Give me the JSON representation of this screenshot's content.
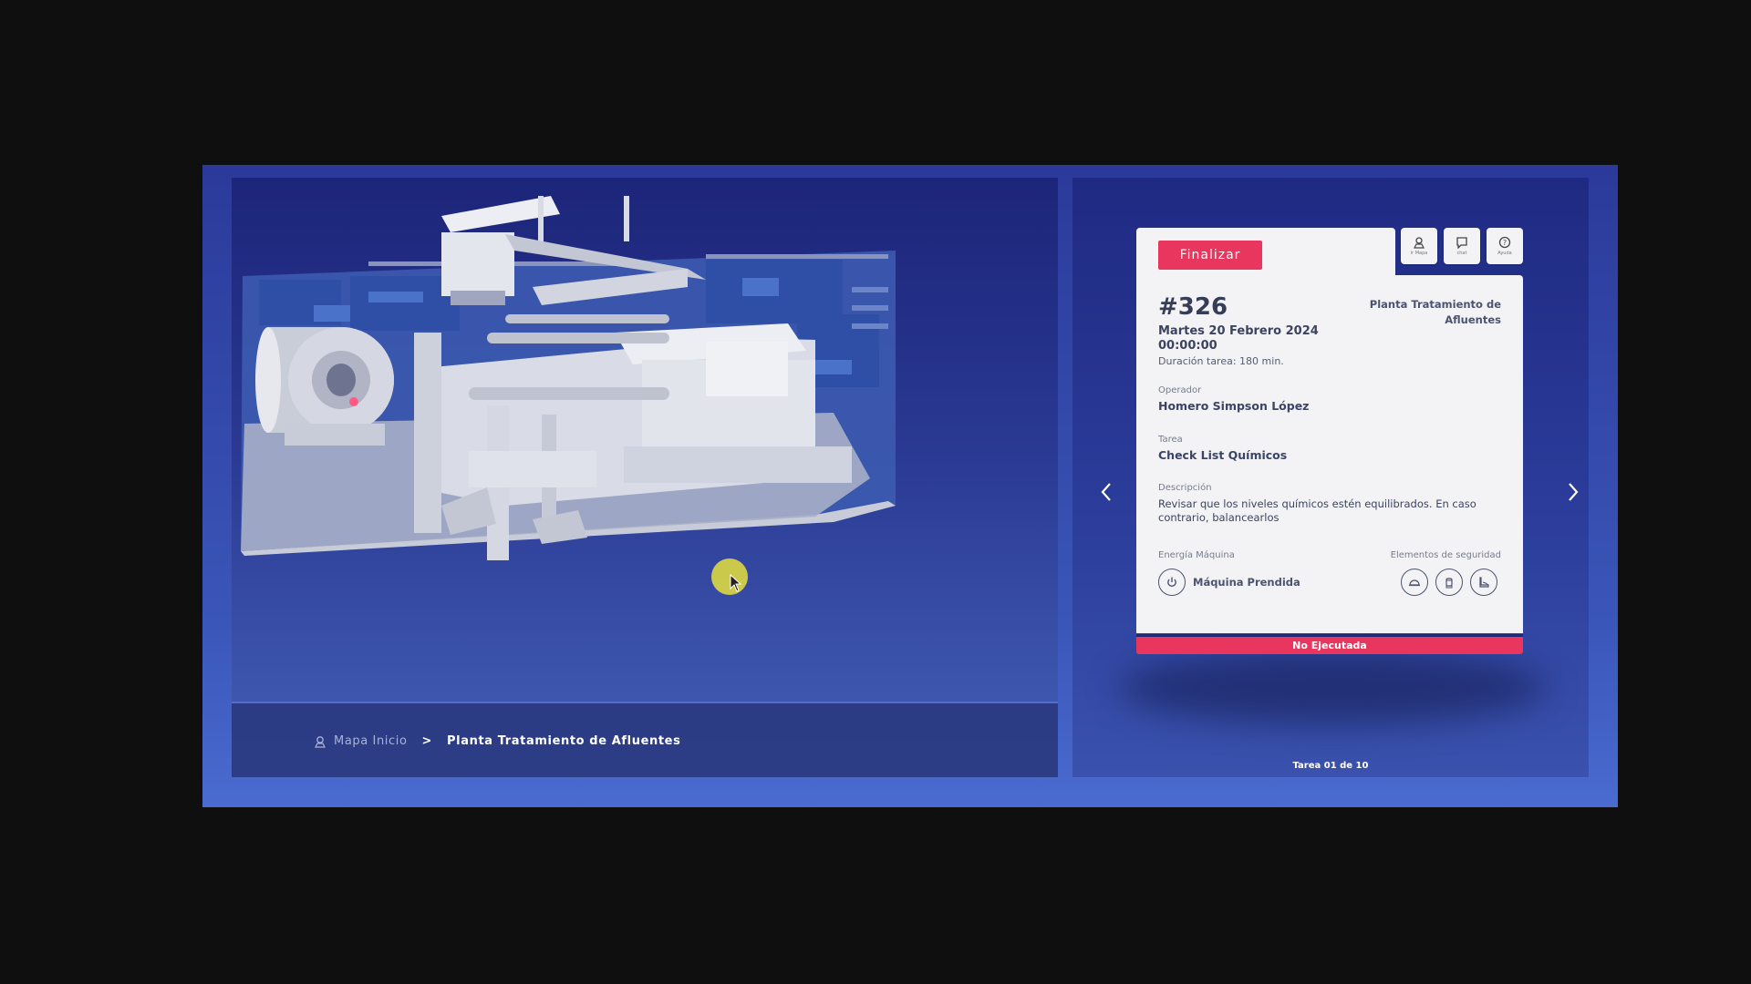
{
  "breadcrumb": {
    "home_label": "Mapa Inicio",
    "separator": ">",
    "current": "Planta Tratamiento de Afluentes"
  },
  "task_card": {
    "finalize_label": "Finalizar",
    "toolbar": [
      {
        "icon": "map-pin-icon",
        "label": "ir Mapa"
      },
      {
        "icon": "chat-icon",
        "label": "chat"
      },
      {
        "icon": "help-icon",
        "label": "Ayuda"
      }
    ],
    "number": "#326",
    "date": "Martes 20 Febrero 2024",
    "time": "00:00:00",
    "duration": "Duración tarea: 180 min.",
    "location": "Planta Tratamiento de Afluentes",
    "operator_label": "Operador",
    "operator": "Homero Simpson López",
    "task_label": "Tarea",
    "task": "Check List Químicos",
    "description_label": "Descripción",
    "description": "Revisar que los niveles químicos estén equilibrados. En caso contrario, balancearlos",
    "energy_label": "Energía Máquina",
    "energy_status": "Máquina Prendida",
    "safety_label": "Elementos de seguridad",
    "safety_icons": [
      "helmet-icon",
      "gloves-icon",
      "boot-icon"
    ],
    "status": "No Ejecutada"
  },
  "pager": "Tarea 01 de 10",
  "colors": {
    "accent": "#e8365f",
    "panel_bg": "#2b3a9a",
    "card_bg": "#f3f3f5",
    "text_dark": "#3b4466"
  }
}
